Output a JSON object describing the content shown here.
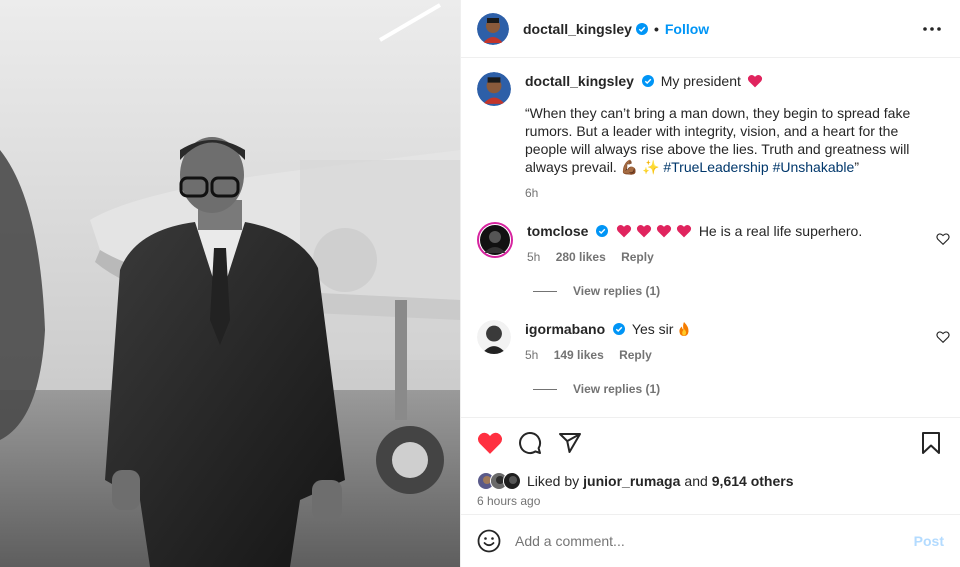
{
  "post": {
    "author": "doctall_kingsley",
    "follow_label": "Follow",
    "dot": "•"
  },
  "caption": {
    "author": "doctall_kingsley",
    "lead": "My president",
    "quote": "“When they can’t bring a man down, they begin to spread fake rumors. But a leader with integrity, vision, and a heart for the people will always rise above the lies. Truth and greatness will always prevail. 💪🏾 ✨",
    "hashtags": "#TrueLeadership #Unshakable",
    "closing_quote": "”",
    "time": "6h"
  },
  "comments": [
    {
      "user": "tomclose",
      "text": "He is a real life superhero.",
      "time": "5h",
      "likes": "280 likes",
      "reply_label": "Reply",
      "view_replies": "View replies (1)"
    },
    {
      "user": "igormabano",
      "text": "Yes sir",
      "time": "5h",
      "likes": "149 likes",
      "reply_label": "Reply",
      "view_replies": "View replies (1)"
    }
  ],
  "likes": {
    "prefix": "Liked by",
    "user": "junior_rumaga",
    "and": "and",
    "others": "9,614 others"
  },
  "posted_ago": "6 hours ago",
  "add_comment": {
    "placeholder": "Add a comment...",
    "post_label": "Post"
  },
  "colors": {
    "accent": "#0095f6",
    "like_red": "#ff3040",
    "muted": "#737373"
  },
  "icons": [
    "more-icon",
    "verified-icon",
    "heart-icon",
    "comment-icon",
    "share-icon",
    "bookmark-icon",
    "emoji-icon",
    "small-heart-icon"
  ]
}
